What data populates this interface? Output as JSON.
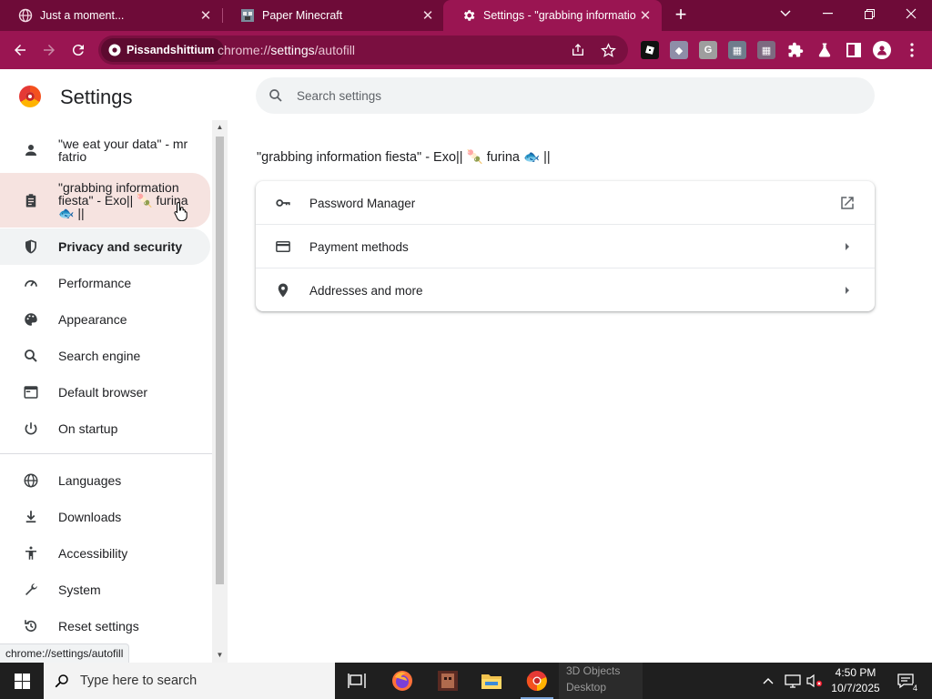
{
  "tabs": [
    {
      "title": "Just a moment...",
      "favicon": "globe-icon"
    },
    {
      "title": "Paper Minecraft",
      "favicon": "minecraft-icon"
    },
    {
      "title": "Settings - \"grabbing information fiesta\" - Exo",
      "favicon": "gear-icon",
      "active": true
    }
  ],
  "window": {
    "new_tab": "+",
    "dropdown": "⌄",
    "minimize": "—",
    "restore": "❐",
    "close": "✕"
  },
  "toolbar": {
    "profile_chip": "Pissandshittium",
    "url_scheme": "chrome://",
    "url_host": "settings",
    "url_path": "/autofill"
  },
  "extensions": [
    "roblox-icon",
    "puzzle-ext-icon",
    "g-ext-icon",
    "image-ext-icon",
    "image-ext-icon-2",
    "extensions-puzzle-icon",
    "flask-icon",
    "sidepanel-icon",
    "profile-icon",
    "menu-dots-icon"
  ],
  "header": {
    "title": "Settings"
  },
  "search": {
    "placeholder": "Search settings"
  },
  "sidebar": {
    "items": [
      {
        "label": "\"we eat your data\" - mr fatrio",
        "icon": "person-icon"
      },
      {
        "label": "\"grabbing information fiesta\" - Exo|| 🍡 furina 🐟 ||",
        "icon": "clipboard-icon",
        "state": "hover"
      },
      {
        "label": "Privacy and security",
        "icon": "shield-icon",
        "state": "active"
      },
      {
        "label": "Performance",
        "icon": "speedometer-icon"
      },
      {
        "label": "Appearance",
        "icon": "palette-icon"
      },
      {
        "label": "Search engine",
        "icon": "search-icon"
      },
      {
        "label": "Default browser",
        "icon": "browser-icon"
      },
      {
        "label": "On startup",
        "icon": "power-icon"
      },
      {
        "label": "Languages",
        "icon": "globe-icon"
      },
      {
        "label": "Downloads",
        "icon": "download-icon"
      },
      {
        "label": "Accessibility",
        "icon": "accessibility-icon"
      },
      {
        "label": "System",
        "icon": "wrench-icon"
      },
      {
        "label": "Reset settings",
        "icon": "reset-icon"
      }
    ]
  },
  "main": {
    "page_title": "\"grabbing information fiesta\" - Exo|| 🍡 furina 🐟 ||",
    "rows": [
      {
        "label": "Password Manager",
        "icon": "key-icon",
        "end": "open-external-icon"
      },
      {
        "label": "Payment methods",
        "icon": "credit-card-icon",
        "end": "arrow-right-icon"
      },
      {
        "label": "Addresses and more",
        "icon": "location-pin-icon",
        "end": "arrow-right-icon"
      }
    ]
  },
  "status_bubble": "chrome://settings/autofill",
  "taskbar": {
    "search_placeholder": "Type here to search",
    "preview_lines": [
      "3D Objects",
      "Desktop"
    ],
    "time": "4:50 PM",
    "date": "10/7/2025",
    "notification_count": "4"
  },
  "colors": {
    "tabstrip": "#6e0b38",
    "toolbar": "#9a1552",
    "hover_row": "#f6e3e0",
    "active_row": "#f1f3f4"
  }
}
